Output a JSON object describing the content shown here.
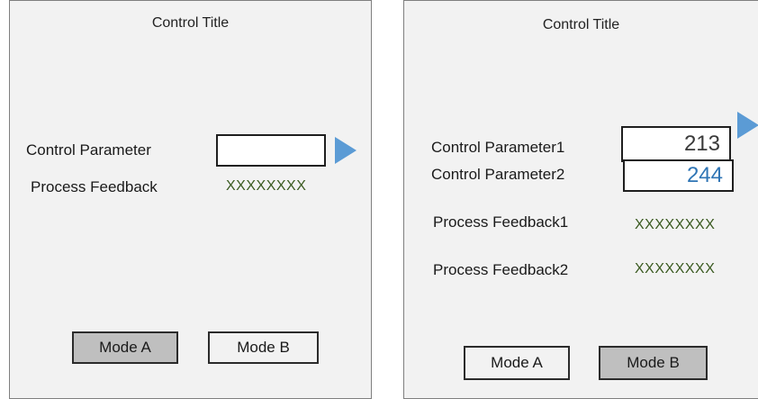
{
  "left_panel": {
    "title": "Control Title",
    "param_label": "Control Parameter",
    "param_value": "",
    "feedback_label": "Process Feedback",
    "feedback_value": "XXXXXXXX",
    "mode_a": "Mode A",
    "mode_b": "Mode B",
    "active_mode": "Mode A"
  },
  "right_panel": {
    "title": "Control Title",
    "param1_label": "Control Parameter1",
    "param1_value": "213",
    "param2_label": "Control Parameter2",
    "param2_value": "244",
    "feedback1_label": "Process Feedback1",
    "feedback1_value": "XXXXXXXX",
    "feedback2_label": "Process Feedback2",
    "feedback2_value": "XXXXXXXX",
    "mode_a": "Mode A",
    "mode_b": "Mode B",
    "active_mode": "Mode B"
  },
  "colors": {
    "panel_bg": "#f2f2f2",
    "feedback_text": "#3a5a20",
    "arrow": "#5b9bd5",
    "param2_value_text": "#2f75b5",
    "active_button": "#bfbfbf"
  },
  "icons": {
    "submit_arrow": "triangle-right-icon"
  }
}
